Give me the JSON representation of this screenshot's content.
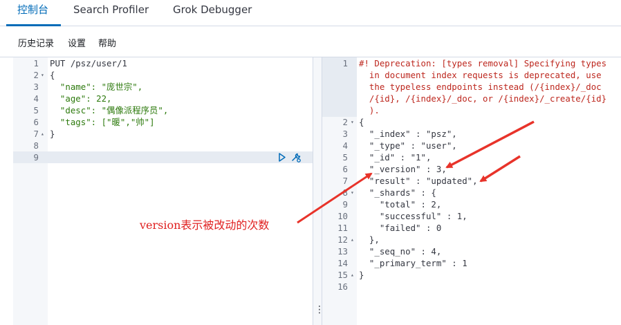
{
  "tabs": [
    {
      "label": "控制台"
    },
    {
      "label": "Search Profiler"
    },
    {
      "label": "Grok Debugger"
    }
  ],
  "toolbar": {
    "history": "历史记录",
    "settings": "设置",
    "help": "帮助"
  },
  "request": {
    "line_numbers": [
      "1",
      "2",
      "3",
      "4",
      "5",
      "6",
      "7",
      "8",
      "9"
    ],
    "lines": [
      "PUT /psz/user/1",
      "{",
      "  \"name\": \"庞世宗\",",
      "  \"age\": 22,",
      "  \"desc\": \"偶像派程序员\",",
      "  \"tags\": [\"暖\",\"帅\"]",
      "}",
      "",
      ""
    ]
  },
  "response": {
    "line_numbers": [
      "1",
      "2",
      "3",
      "4",
      "5",
      "6",
      "7",
      "8",
      "9",
      "10",
      "11",
      "12",
      "13",
      "14",
      "15",
      "16"
    ],
    "warning_lines": [
      "#! Deprecation: [types removal] Specifying types",
      "  in document index requests is deprecated, use",
      "  the typeless endpoints instead (/{index}/_doc",
      "  /{id}, /{index}/_doc, or /{index}/_create/{id}",
      "  )."
    ],
    "lines": [
      "{",
      "  \"_index\" : \"psz\",",
      "  \"_type\" : \"user\",",
      "  \"_id\" : \"1\",",
      "  \"_version\" : 3,",
      "  \"result\" : \"updated\",",
      "  \"_shards\" : {",
      "    \"total\" : 2,",
      "    \"successful\" : 1,",
      "    \"failed\" : 0",
      "  },",
      "  \"_seq_no\" : 4,",
      "  \"_primary_term\" : 1",
      "}",
      ""
    ]
  },
  "annotation": {
    "text": "version表示被改动的次数"
  },
  "icons": {
    "run": "play-icon",
    "settings": "wrench-icon",
    "splitter": "vertical-dots-icon"
  },
  "colors": {
    "accent": "#006bb8",
    "warning": "#bd271e",
    "string": "#2d7a0d",
    "annotation": "#e02020"
  }
}
